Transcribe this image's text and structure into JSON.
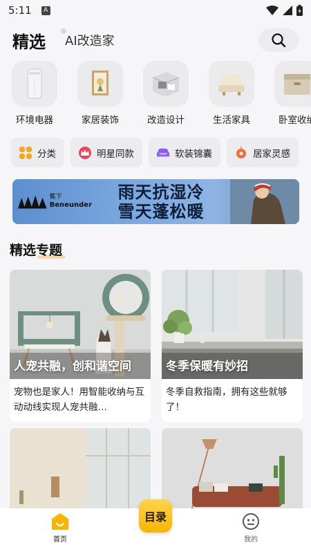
{
  "status_bar": {
    "time": "5:11",
    "badge": "A"
  },
  "header": {
    "tab_main": "精选",
    "tab_ai": "AI改造家"
  },
  "categories": [
    {
      "label": "环境电器",
      "icon": "air-purifier-icon"
    },
    {
      "label": "家居装饰",
      "icon": "picture-frame-icon"
    },
    {
      "label": "改造设计",
      "icon": "room-model-icon"
    },
    {
      "label": "生活家具",
      "icon": "armchair-icon"
    },
    {
      "label": "卧室收纳",
      "icon": "storage-box-icon"
    }
  ],
  "chips": [
    {
      "label": "分类",
      "icon": "grid-icon",
      "color": "#f5a623"
    },
    {
      "label": "明星同款",
      "icon": "crown-icon",
      "color": "#e8445a"
    },
    {
      "label": "软装锦囊",
      "icon": "sofa-icon",
      "color": "#8a5cf6"
    },
    {
      "label": "居家灵感",
      "icon": "bulb-icon",
      "color": "#f26b3a"
    }
  ],
  "banner": {
    "brand_cn": "蕉下",
    "brand_en": "Beneunder",
    "line1": "雨天抗湿冷",
    "line2": "雪天蓬松暖"
  },
  "section_title": "精选专题",
  "cards": [
    {
      "caption": "人宠共融，创和谐空间",
      "desc": "宠物也是家人！用智能收纳与互动动线实现人宠共融…"
    },
    {
      "caption": "冬季保暖有妙招",
      "desc": "冬季自救指南，拥有这些就够了！"
    },
    {
      "caption": "",
      "desc": ""
    },
    {
      "caption": "",
      "desc": ""
    }
  ],
  "bottom_nav": {
    "home_label": "首页",
    "center_label": "目录",
    "mine_label": "我的"
  },
  "colors": {
    "accent": "#f7b500",
    "background": "#f6f6f8"
  }
}
